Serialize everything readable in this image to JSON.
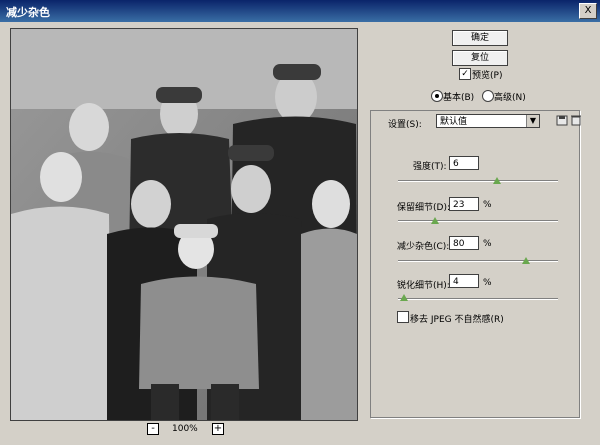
{
  "window": {
    "title": "减少杂色",
    "close_label": "X"
  },
  "buttons": {
    "ok": "确定",
    "reset": "复位"
  },
  "preview_label": "预览(P)",
  "mode": {
    "basic": "基本(B)",
    "advanced": "高级(N)"
  },
  "settings": {
    "label": "设置(S):",
    "value": "默认值"
  },
  "sliders": [
    {
      "label": "强度(T):",
      "value": "6",
      "unit": "",
      "fraction": 0.62
    },
    {
      "label": "保留细节(D):",
      "value": "23",
      "unit": "%",
      "fraction": 0.23
    },
    {
      "label": "减少杂色(C):",
      "value": "80",
      "unit": "%",
      "fraction": 0.8
    },
    {
      "label": "锐化细节(H):",
      "value": "4",
      "unit": "%",
      "fraction": 0.04
    }
  ],
  "remove_jpeg_label": "移去 JPEG 不自然感(R)",
  "zoom": {
    "minus": "-",
    "plus": "+",
    "value": "100%"
  },
  "icons": {
    "save": "save-preset-icon",
    "delete": "trash-icon"
  }
}
